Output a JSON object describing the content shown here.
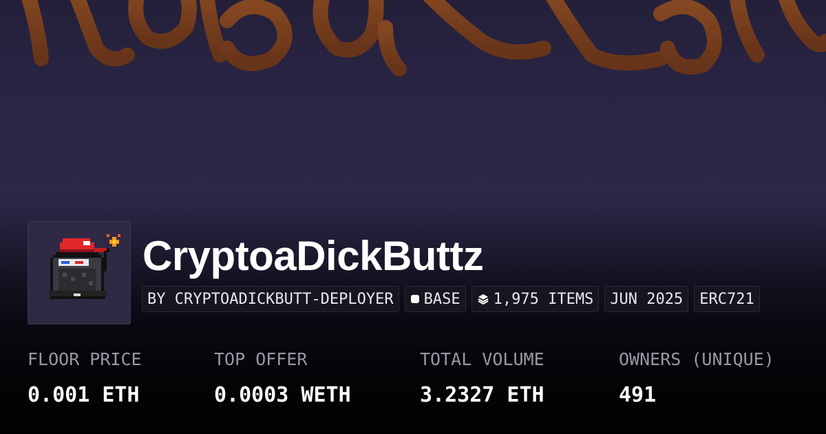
{
  "collection": {
    "name": "CryptoaDickButtz",
    "creator": "BY CRYPTOADICKBUTT-DEPLOYER",
    "chain": "BASE",
    "items": "1,975 ITEMS",
    "date": "JUN 2025",
    "standard": "ERC721"
  },
  "icons": {
    "chain": "base-chain-icon",
    "items": "layers-icon"
  },
  "stats": [
    {
      "label": "FLOOR PRICE",
      "value": "0.001 ETH"
    },
    {
      "label": "TOP OFFER",
      "value": "0.0003 WETH"
    },
    {
      "label": "TOTAL VOLUME",
      "value": "3.2327 ETH"
    },
    {
      "label": "OWNERS (UNIQUE)",
      "value": "491"
    }
  ],
  "colors": {
    "banner_text": "#7a3f1c",
    "banner_bg": "#2a2545",
    "label": "#9a97a6",
    "chip_bg": "#17151f"
  }
}
